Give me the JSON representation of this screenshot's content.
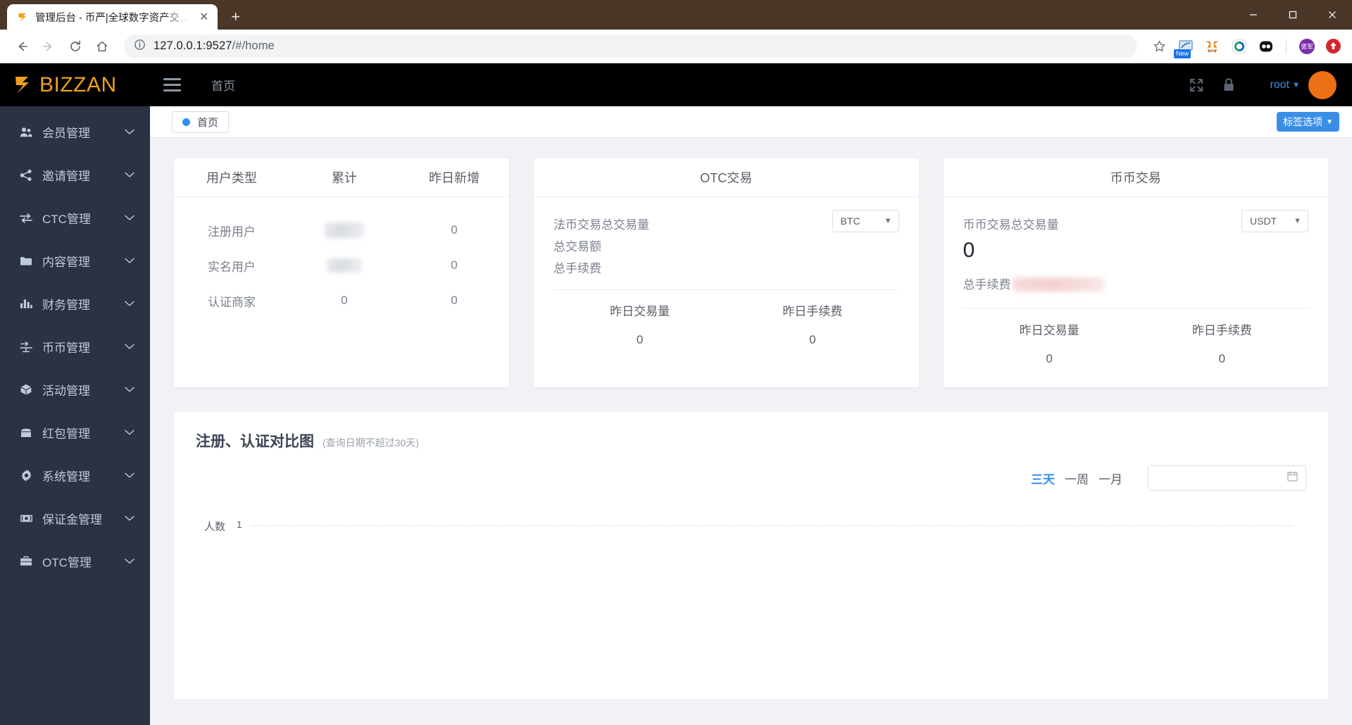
{
  "browser": {
    "tab_title": "管理后台 - 币严|全球数字资产交…",
    "close_tab_glyph": "✕",
    "new_tab_glyph": "+",
    "minimize_glyph": "—",
    "maximize_glyph": "□",
    "close_window_glyph": "✕",
    "back_glyph": "←",
    "forward_glyph": "→",
    "reload_glyph": "⟳",
    "home_glyph": "⌂",
    "info_glyph": "ⓘ",
    "url_host": "127.0.0.1:9527",
    "url_path": "/#/home",
    "bookmark_glyph": "☆",
    "extensions": [
      {
        "name": "new-badge-extension-icon",
        "label": "New"
      },
      {
        "name": "metamask-extension-icon",
        "label": ""
      },
      {
        "name": "circle-extension-icon",
        "label": ""
      },
      {
        "name": "panda-extension-icon",
        "label": ""
      },
      {
        "name": "xianjun-profile-icon",
        "label": "贤军"
      },
      {
        "name": "update-extension-icon",
        "label": ""
      }
    ]
  },
  "sidebar": {
    "logo_text": "BIZZAN",
    "items": [
      {
        "label": "会员管理",
        "icon": "users-icon"
      },
      {
        "label": "邀请管理",
        "icon": "share-icon"
      },
      {
        "label": "CTC管理",
        "icon": "exchange-arrows-icon"
      },
      {
        "label": "内容管理",
        "icon": "folder-icon"
      },
      {
        "label": "财务管理",
        "icon": "bar-chart-icon"
      },
      {
        "label": "币币管理",
        "icon": "coin-exchange-icon"
      },
      {
        "label": "活动管理",
        "icon": "box-icon"
      },
      {
        "label": "红包管理",
        "icon": "envelope-icon"
      },
      {
        "label": "系统管理",
        "icon": "gear-icon"
      },
      {
        "label": "保证金管理",
        "icon": "banknote-icon"
      },
      {
        "label": "OTC管理",
        "icon": "briefcase-icon"
      }
    ],
    "expand_glyph": "⌄"
  },
  "topbar": {
    "breadcrumb": "首页",
    "fullscreen_icon": "fullscreen-icon",
    "lock_icon": "lock-icon",
    "user_name": "root",
    "user_caret": "▼"
  },
  "tagbar": {
    "tag_label": "首页",
    "tag_options_label": "标签选项",
    "tag_options_caret": "▼"
  },
  "cards": {
    "users": {
      "headers": [
        "用户类型",
        "累计",
        "昨日新增"
      ],
      "rows": [
        {
          "type": "注册用户",
          "total": "",
          "total_blurred": true,
          "yesterday": "0"
        },
        {
          "type": "实名用户",
          "total": "",
          "total_blurred": true,
          "yesterday": "0"
        },
        {
          "type": "认证商家",
          "total": "0",
          "total_blurred": false,
          "yesterday": "0"
        }
      ]
    },
    "otc": {
      "title": "OTC交易",
      "currency": "BTC",
      "line1": "法币交易总交易量",
      "line2": "总交易额",
      "line3": "总手续费",
      "footer_labels": [
        "昨日交易量",
        "昨日手续费"
      ],
      "footer_values": [
        "0",
        "0"
      ]
    },
    "coin": {
      "title": "币币交易",
      "currency": "USDT",
      "total_label": "币币交易总交易量",
      "total_value": "0",
      "fee_label": "总手续费",
      "fee_value": "",
      "fee_blurred": true,
      "footer_labels": [
        "昨日交易量",
        "昨日手续费"
      ],
      "footer_values": [
        "0",
        "0"
      ]
    }
  },
  "chart_panel": {
    "title": "注册、认证对比图",
    "subtitle": "(查询日期不超过30天)",
    "ranges": [
      {
        "label": "三天",
        "active": true
      },
      {
        "label": "一周",
        "active": false
      },
      {
        "label": "一月",
        "active": false
      }
    ],
    "date_placeholder": "",
    "date_value": "",
    "calendar_icon": "calendar-icon"
  },
  "chart_data": {
    "type": "line",
    "title": "注册、认证对比图",
    "subtitle": "(查询日期不超过30天)",
    "ylabel": "人数",
    "xlabel": "",
    "categories": [],
    "series": [],
    "yticks": [
      "1"
    ],
    "ylim": [
      0,
      1
    ],
    "grid": true,
    "legend_position": "none",
    "range_selected": "三天"
  },
  "colors": {
    "brand_orange": "#eda11a",
    "accent_blue": "#3a8ee6",
    "sidebar_bg": "#2b3243",
    "topbar_bg": "#000000",
    "content_bg": "#f0f2f5",
    "avatar": "#ec7014"
  }
}
